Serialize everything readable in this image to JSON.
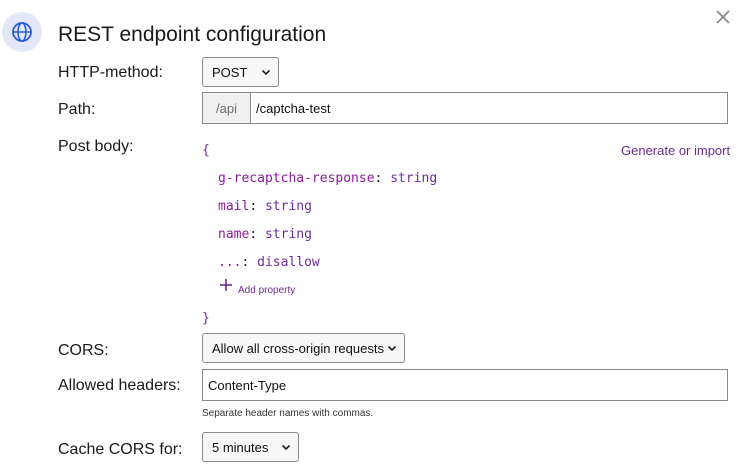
{
  "dialog": {
    "title": "REST endpoint configuration",
    "icon": "globe-icon",
    "close_icon": "close-icon"
  },
  "http_method": {
    "label": "HTTP-method:",
    "selected": "POST"
  },
  "path": {
    "label": "Path:",
    "prefix": "/api",
    "value": "/captcha-test"
  },
  "post_body": {
    "label": "Post body:",
    "generate_link": "Generate or import",
    "open_brace": "{",
    "close_brace": "}",
    "properties": [
      {
        "key": "g-recaptcha-response",
        "colon": ":",
        "type": "string"
      },
      {
        "key": "mail",
        "colon": ":",
        "type": "string"
      },
      {
        "key": "name",
        "colon": ":",
        "type": "string"
      },
      {
        "key": "...",
        "colon": ":",
        "type": "disallow"
      }
    ],
    "add_property": "Add property"
  },
  "cors": {
    "label": "CORS:",
    "selected": "Allow all cross-origin requests"
  },
  "allowed_headers": {
    "label": "Allowed headers:",
    "value": "Content-Type",
    "help": "Separate header names with commas."
  },
  "cache_cors": {
    "label": "Cache CORS for:",
    "selected": "5 minutes"
  },
  "colors": {
    "accent_purple": "#6f2a8a",
    "badge_bg": "#e3e8f7",
    "globe_blue": "#2a5bd7"
  }
}
